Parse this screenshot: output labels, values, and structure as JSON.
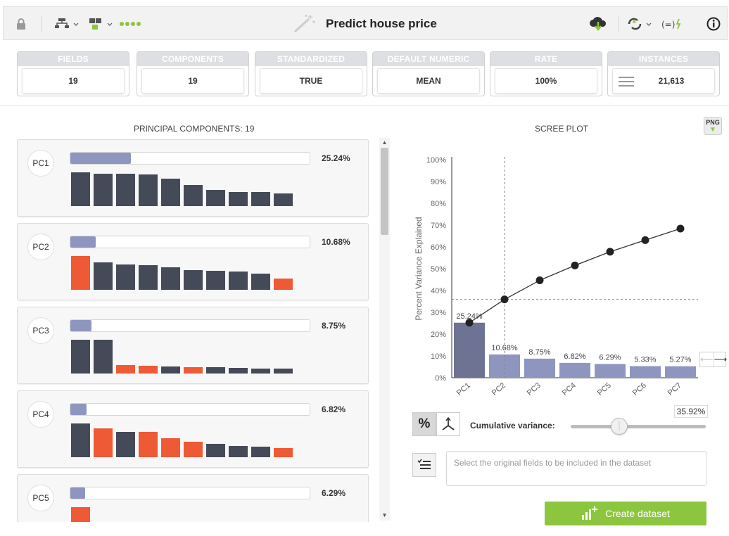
{
  "toolbar": {
    "title": "Predict house price",
    "icons": [
      "lock-icon",
      "model-tree-icon",
      "ensemble-icon",
      "progress-dots-icon",
      "wand-icon",
      "cloud-download-icon",
      "recycle-icon",
      "formula-icon",
      "info-icon"
    ]
  },
  "summary": [
    {
      "label": "FIELDS",
      "value": "19"
    },
    {
      "label": "COMPONENTS",
      "value": "19"
    },
    {
      "label": "STANDARDIZED",
      "value": "TRUE"
    },
    {
      "label": "DEFAULT NUMERIC",
      "value": "MEAN"
    },
    {
      "label": "RATE",
      "value": "100%"
    },
    {
      "label": "INSTANCES",
      "value": "21,613"
    }
  ],
  "components_panel": {
    "title": "PRINCIPAL COMPONENTS: 19",
    "items": [
      {
        "name": "PC1",
        "pct_label": "25.24%",
        "pct": 25.24,
        "bars": [
          {
            "h": 1.0,
            "c": "dark"
          },
          {
            "h": 0.96,
            "c": "dark"
          },
          {
            "h": 0.96,
            "c": "dark"
          },
          {
            "h": 0.94,
            "c": "dark"
          },
          {
            "h": 0.82,
            "c": "dark"
          },
          {
            "h": 0.62,
            "c": "dark"
          },
          {
            "h": 0.48,
            "c": "dark"
          },
          {
            "h": 0.42,
            "c": "dark"
          },
          {
            "h": 0.42,
            "c": "dark"
          },
          {
            "h": 0.38,
            "c": "dark"
          }
        ]
      },
      {
        "name": "PC2",
        "pct_label": "10.68%",
        "pct": 10.68,
        "bars": [
          {
            "h": 1.0,
            "c": "orange"
          },
          {
            "h": 0.82,
            "c": "dark"
          },
          {
            "h": 0.76,
            "c": "dark"
          },
          {
            "h": 0.72,
            "c": "dark"
          },
          {
            "h": 0.66,
            "c": "dark"
          },
          {
            "h": 0.58,
            "c": "dark"
          },
          {
            "h": 0.56,
            "c": "dark"
          },
          {
            "h": 0.54,
            "c": "dark"
          },
          {
            "h": 0.48,
            "c": "dark"
          },
          {
            "h": 0.34,
            "c": "orange"
          }
        ]
      },
      {
        "name": "PC3",
        "pct_label": "8.75%",
        "pct": 8.75,
        "bars": [
          {
            "h": 1.0,
            "c": "dark"
          },
          {
            "h": 1.0,
            "c": "dark"
          },
          {
            "h": 0.26,
            "c": "orange"
          },
          {
            "h": 0.22,
            "c": "orange"
          },
          {
            "h": 0.2,
            "c": "dark"
          },
          {
            "h": 0.18,
            "c": "orange"
          },
          {
            "h": 0.18,
            "c": "dark"
          },
          {
            "h": 0.16,
            "c": "dark"
          },
          {
            "h": 0.14,
            "c": "dark"
          },
          {
            "h": 0.14,
            "c": "dark"
          }
        ]
      },
      {
        "name": "PC4",
        "pct_label": "6.82%",
        "pct": 6.82,
        "bars": [
          {
            "h": 1.0,
            "c": "dark"
          },
          {
            "h": 0.86,
            "c": "orange"
          },
          {
            "h": 0.76,
            "c": "dark"
          },
          {
            "h": 0.74,
            "c": "orange"
          },
          {
            "h": 0.56,
            "c": "orange"
          },
          {
            "h": 0.46,
            "c": "orange"
          },
          {
            "h": 0.4,
            "c": "dark"
          },
          {
            "h": 0.34,
            "c": "dark"
          },
          {
            "h": 0.32,
            "c": "dark"
          },
          {
            "h": 0.28,
            "c": "orange"
          }
        ]
      },
      {
        "name": "PC5",
        "pct_label": "6.29%",
        "pct": 6.29,
        "bars": [
          {
            "h": 1.0,
            "c": "orange"
          }
        ]
      }
    ]
  },
  "scree": {
    "title": "SCREE PLOT",
    "png_label": "PNG",
    "cumulative_label": "Cumulative variance:",
    "cumulative_value": "35.92%",
    "cumulative_pct": 35.92,
    "fields_placeholder": "Select the original fields to be included in the dataset",
    "create_label": "Create dataset"
  },
  "chart_data": {
    "type": "bar",
    "ylabel": "Percent Variance Explained",
    "yticks": [
      "0%",
      "10%",
      "20%",
      "30%",
      "40%",
      "50%",
      "60%",
      "70%",
      "80%",
      "90%",
      "100%"
    ],
    "ylim": [
      0,
      100
    ],
    "categories": [
      "PC1",
      "PC2",
      "PC3",
      "PC4",
      "PC5",
      "PC6",
      "PC7"
    ],
    "values": [
      25.24,
      10.68,
      8.75,
      6.82,
      6.29,
      5.33,
      5.27
    ],
    "value_labels": [
      "25.24%",
      "10.68%",
      "8.75%",
      "6.82%",
      "6.29%",
      "5.33%",
      "5.27%"
    ],
    "cumulative": [
      25.24,
      35.92,
      44.67,
      51.49,
      57.78,
      63.11,
      68.38
    ],
    "threshold_y": 35.92,
    "threshold_component": "PC2",
    "colors": {
      "first_bar": "#6e7394",
      "other_bars": "#8e96c0",
      "line": "#333333",
      "dark_bar": "#454a58",
      "orange_bar": "#ee5a36",
      "accent_green": "#8cc63e"
    }
  }
}
